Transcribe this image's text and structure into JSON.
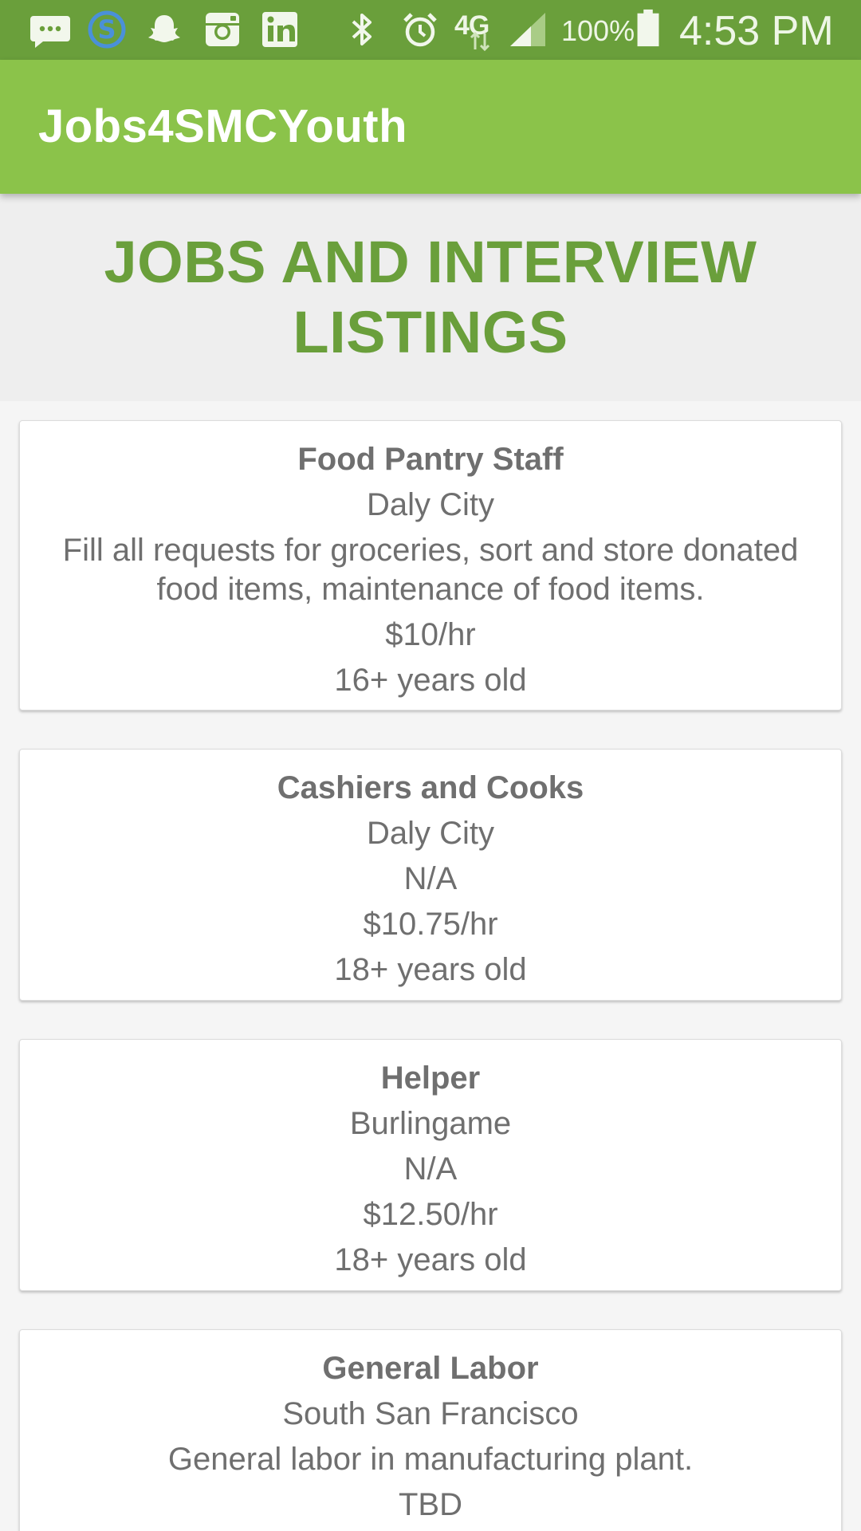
{
  "status_bar": {
    "icons": [
      "message-icon",
      "skype-icon",
      "snapchat-icon",
      "instagram-icon",
      "linkedin-icon",
      "bluetooth-icon",
      "alarm-icon",
      "lte-icon",
      "signal-icon",
      "battery-icon"
    ],
    "network_label": "4G",
    "battery_percent": "100%",
    "time": "4:53 PM"
  },
  "app_bar": {
    "title": "Jobs4SMCYouth"
  },
  "section": {
    "title": "JOBS AND INTERVIEW LISTINGS"
  },
  "colors": {
    "status_bar": "#6a9f3b",
    "app_bar": "#8bc34a",
    "heading": "#6a9f3b",
    "card_text": "#6f6f6f"
  },
  "jobs": [
    {
      "title": "Food Pantry Staff",
      "location": "Daly City",
      "description": "Fill all requests for groceries, sort and store donated food items, maintenance of food items.",
      "pay": "$10/hr",
      "age": "16+ years old"
    },
    {
      "title": "Cashiers and Cooks",
      "location": "Daly City",
      "description": "N/A",
      "pay": "$10.75/hr",
      "age": "18+ years old"
    },
    {
      "title": "Helper",
      "location": "Burlingame",
      "description": "N/A",
      "pay": "$12.50/hr",
      "age": "18+ years old"
    },
    {
      "title": "General Labor",
      "location": "South San Francisco",
      "description": "General labor in manufacturing plant.",
      "pay": "TBD"
    }
  ]
}
